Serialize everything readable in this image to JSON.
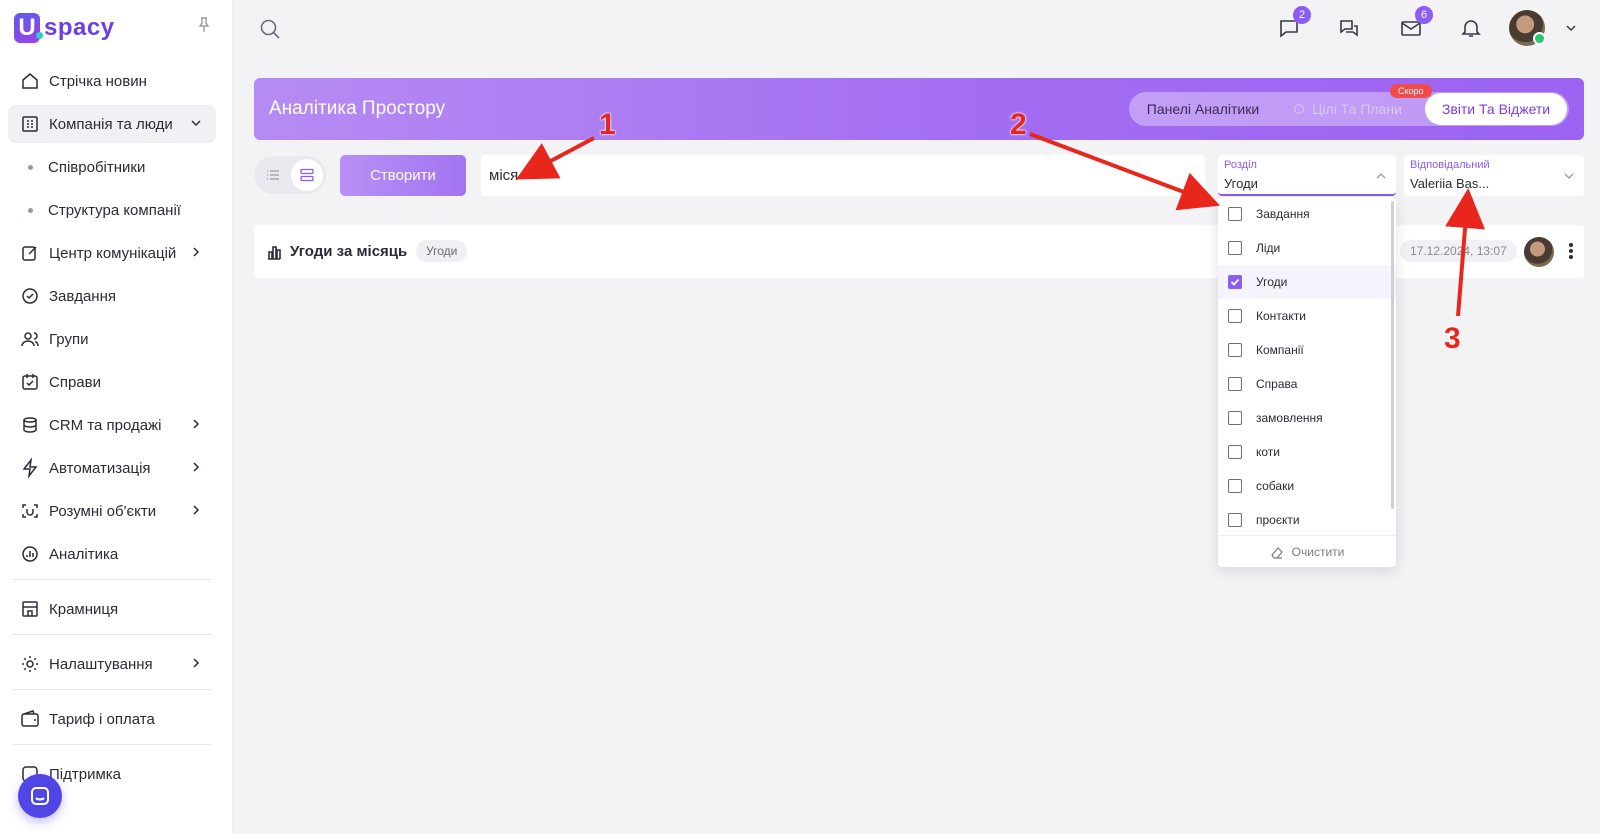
{
  "brand": {
    "logo_letter": "U",
    "logo_text": "spacy"
  },
  "sidebar": {
    "items": [
      {
        "label": "Стрічка новин",
        "icon": "home-icon"
      },
      {
        "label": "Компанія та люди",
        "icon": "building-icon",
        "expanded": true
      },
      {
        "label": "Співробітники",
        "sub": true
      },
      {
        "label": "Структура компанії",
        "sub": true
      },
      {
        "label": "Центр комунікацій",
        "icon": "edit-icon",
        "chevron": true
      },
      {
        "label": "Завдання",
        "icon": "check-circle-icon"
      },
      {
        "label": "Групи",
        "icon": "users-icon"
      },
      {
        "label": "Справи",
        "icon": "calendar-check-icon"
      },
      {
        "label": "CRM та продажі",
        "icon": "database-icon",
        "chevron": true
      },
      {
        "label": "Автоматизація",
        "icon": "lightning-icon",
        "chevron": true
      },
      {
        "label": "Розумні об'єкти",
        "icon": "scan-icon",
        "chevron": true
      },
      {
        "label": "Аналітика",
        "icon": "chart-circle-icon"
      },
      {
        "label": "Крамниця",
        "icon": "store-icon"
      },
      {
        "label": "Налаштування",
        "icon": "gear-icon",
        "chevron": true
      },
      {
        "label": "Тариф і оплата",
        "icon": "wallet-icon"
      },
      {
        "label": "Підтримка",
        "icon": "help-icon"
      }
    ]
  },
  "topbar": {
    "chat_badge": "2",
    "mail_badge": "6"
  },
  "banner": {
    "title": "Аналітика Простору",
    "tabs": [
      "Панелі Аналітики",
      "Цілі Та Плани",
      "Звіти Та Віджети"
    ],
    "soon_label": "Скоро"
  },
  "toolbar": {
    "create_label": "Створити",
    "search_value": "міся"
  },
  "filters": {
    "section": {
      "label": "Розділ",
      "value": "Угоди",
      "options": [
        {
          "label": "Завдання",
          "checked": false
        },
        {
          "label": "Ліди",
          "checked": false
        },
        {
          "label": "Угоди",
          "checked": true
        },
        {
          "label": "Контакти",
          "checked": false
        },
        {
          "label": "Компанії",
          "checked": false
        },
        {
          "label": "Справа",
          "checked": false
        },
        {
          "label": "замовлення",
          "checked": false
        },
        {
          "label": "коти",
          "checked": false
        },
        {
          "label": "собаки",
          "checked": false
        },
        {
          "label": "проєкти",
          "checked": false
        }
      ],
      "clear_label": "Очистити"
    },
    "responsible": {
      "label": "Відповідальний",
      "value": "Valeriia Bas..."
    }
  },
  "reports": [
    {
      "title": "Угоди за місяць",
      "tag": "Угоди",
      "date": "17.12.2024, 13:07"
    }
  ],
  "annotations": [
    "1",
    "2",
    "3"
  ],
  "colors": {
    "accent": "#8b5cf6",
    "arrow": "#e8261b"
  }
}
